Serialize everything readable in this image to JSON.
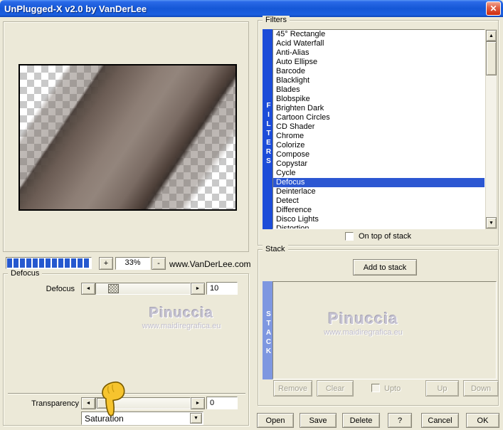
{
  "window": {
    "title": "UnPlugged-X v2.0 by VanDerLee",
    "close_glyph": "✕"
  },
  "icons": {
    "left": "◄",
    "right": "►",
    "up": "▲",
    "down": "▼",
    "dropdown": "▼"
  },
  "preview": {
    "zoom_in_label": "+",
    "zoom_value": "33%",
    "zoom_out_label": "-",
    "site_link": "www.VanDerLee.com"
  },
  "filters": {
    "group_label": "Filters",
    "side_label": "FILTERS",
    "on_top_label": "On top of stack",
    "selected": "Defocus",
    "items": [
      "45° Rectangle",
      "Acid Waterfall",
      "Anti-Alias",
      "Auto Ellipse",
      "Barcode",
      "Blacklight",
      "Blades",
      "Blobspike",
      "Brighten Dark",
      "Cartoon Circles",
      "CD Shader",
      "Chrome",
      "Colorize",
      "Compose",
      "Copystar",
      "Cycle",
      {
        "label": "Defocus",
        "selected": true
      },
      "Deinterlace",
      "Detect",
      "Difference",
      "Disco Lights",
      "Distortion"
    ]
  },
  "defocus": {
    "group_label": "Defocus",
    "slider_label": "Defocus",
    "slider_value": "10",
    "transparency_label": "Transparency",
    "transparency_value": "0",
    "mode_value": "Saturation",
    "watermark_name": "Pinuccia",
    "watermark_url": "www.maidiregrafica.eu"
  },
  "stack": {
    "group_label": "Stack",
    "side_label": "STACK",
    "add_label": "Add to stack",
    "remove_label": "Remove",
    "clear_label": "Clear",
    "upto_label": "Upto",
    "up_label": "Up",
    "down_label": "Down",
    "watermark_name": "Pinuccia",
    "watermark_url": "www.maidiregrafica.eu"
  },
  "footer": {
    "open": "Open",
    "save": "Save",
    "delete": "Delete",
    "help": "?",
    "cancel": "Cancel",
    "ok": "OK"
  },
  "colors": {
    "window_bg": "#ece9d8",
    "title_blue": "#1557d6",
    "selection_blue": "#2c57d2",
    "filters_bar": "#1c4cd8",
    "stack_bar": "#7e97e0",
    "close_red": "#cf2c0e"
  }
}
